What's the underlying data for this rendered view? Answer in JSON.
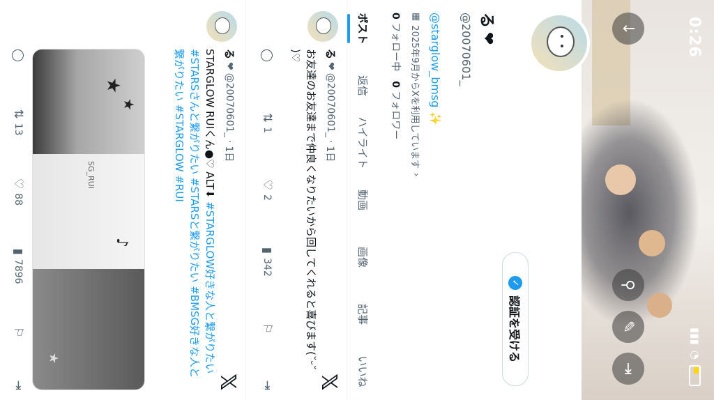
{
  "status": {
    "time": "0:26",
    "battery_color": "#ffd60a"
  },
  "header": {
    "back_icon": "arrow-down-icon",
    "actions": [
      {
        "name": "search",
        "icon": "search-icon"
      },
      {
        "name": "edit",
        "icon": "pencil-icon"
      },
      {
        "name": "share",
        "icon": "exit-icon"
      }
    ]
  },
  "profile": {
    "verify_button": "認証を受ける",
    "name": "る",
    "handle": "@20070601_",
    "bio": "@starglow_bmsg",
    "joined": "2025年9月からXを利用しています",
    "following_count": "0",
    "following_label": "フォロー中",
    "followers_count": "0",
    "followers_label": "フォロワー"
  },
  "tabs": [
    "ポスト",
    "返信",
    "ハイライト",
    "動画",
    "画像",
    "記事",
    "いいね"
  ],
  "posts": [
    {
      "name": "る",
      "handle": "@20070601_",
      "time": "1日",
      "text": "お友達のお友達まで仲良くなりたいから回してくれると喜びます(˘ᵕ˘ )♡",
      "replies": "",
      "reposts": "1",
      "likes": "2",
      "views": "342"
    },
    {
      "name": "る",
      "handle": "@20070601_",
      "time": "1日",
      "text_prefix": "STARGLOW RUIくん",
      "alt_label": "ALT",
      "tags": "#STARGLOW好きな人と繋がりたい #STARSさんと繋がりたい #STARSと繋がりたい #BMSG好きな人と繋がりたい #STARGLOW #RUI",
      "replies": "",
      "reposts": "13",
      "likes": "88",
      "views": "7896",
      "media_text": "SG_RUI"
    }
  ],
  "colors": {
    "accent": "#1d9bf0",
    "text": "#0f1419",
    "muted": "#536471"
  }
}
